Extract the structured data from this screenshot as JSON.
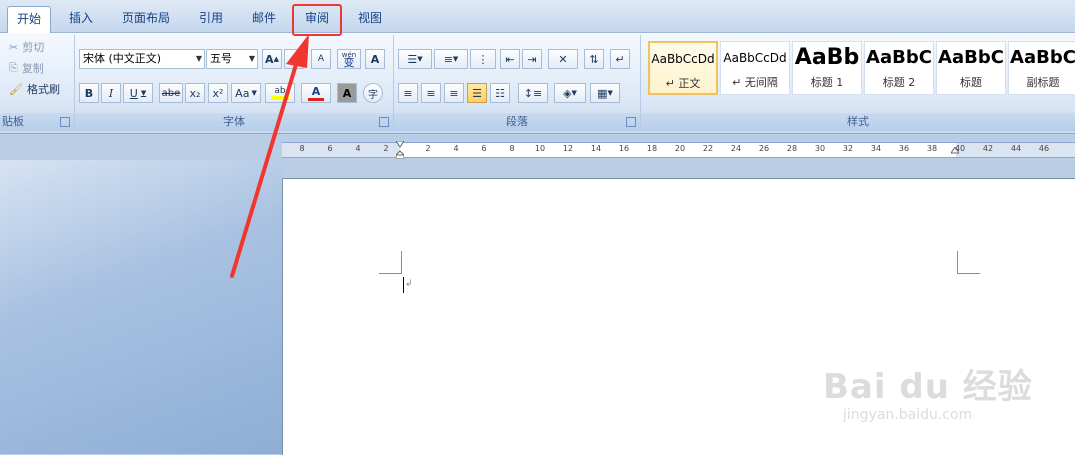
{
  "tabs": [
    {
      "label": "开始",
      "active": true
    },
    {
      "label": "插入"
    },
    {
      "label": "页面布局"
    },
    {
      "label": "引用"
    },
    {
      "label": "邮件"
    },
    {
      "label": "审阅"
    },
    {
      "label": "视图"
    }
  ],
  "clipboard": {
    "cut": "剪切",
    "copy": "复制",
    "format_painter": "格式刷",
    "group_label": "贴板"
  },
  "font": {
    "font_name": "宋体 (中文正文)",
    "font_size": "五号",
    "grow": "A",
    "shrink": "A",
    "clear": "A",
    "pinyin": "wén",
    "pinyin_char": "变",
    "border_char": "A",
    "bold": "B",
    "italic": "I",
    "underline": "U",
    "strike": "abe",
    "sub": "x₂",
    "sup": "x²",
    "case": "Aa",
    "highlight": "ab",
    "color_a": "A",
    "shade_a": "A",
    "circle_char": "字",
    "group_label": "字体"
  },
  "paragraph": {
    "group_label": "段落"
  },
  "styles": {
    "items": [
      {
        "preview": "AaBbCcDd",
        "name": "↵ 正文",
        "active": true
      },
      {
        "preview": "AaBbCcDd",
        "name": "↵ 无间隔"
      },
      {
        "preview": "AaBb",
        "name": "标题 1"
      },
      {
        "preview": "AaBbC",
        "name": "标题 2"
      },
      {
        "preview": "AaBbC",
        "name": "标题"
      },
      {
        "preview": "AaBbC",
        "name": "副标题"
      }
    ],
    "group_label": "样式"
  },
  "ruler": {
    "left_ticks": [
      "8",
      "6",
      "4",
      "2"
    ],
    "right_ticks": [
      "2",
      "4",
      "6",
      "8",
      "10",
      "12",
      "14",
      "16",
      "18",
      "20",
      "22",
      "24",
      "26",
      "28",
      "30",
      "32",
      "34",
      "36",
      "38",
      "40",
      "42",
      "44",
      "46"
    ]
  },
  "watermark": {
    "brand": "Bai du 经验",
    "url": "jingyan.baidu.com"
  },
  "colors": {
    "highlight_box": "#e83a30",
    "arrow": "#f0362e",
    "font_color": "#e0201b",
    "highlight_color": "#ffff00"
  }
}
